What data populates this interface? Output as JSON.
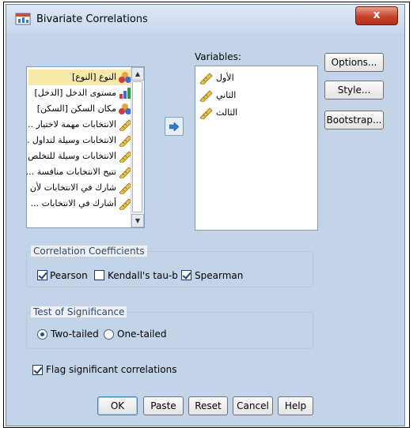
{
  "window": {
    "title": "Bivariate Correlations",
    "close_glyph": "x"
  },
  "source_list": {
    "items": [
      {
        "label": "النوع [النوع]",
        "icon": "nominal-icon",
        "selected": true
      },
      {
        "label": "مستوى الدخل [الدخل]",
        "icon": "ordinal-icon",
        "selected": false
      },
      {
        "label": "مكان السكن [السكن]",
        "icon": "nominal-icon",
        "selected": false
      },
      {
        "label": "الانتخابات مهمة لاختيار ...",
        "icon": "scale-icon",
        "selected": false
      },
      {
        "label": "الانتخابات وسيلة لتداول ...",
        "icon": "scale-icon",
        "selected": false
      },
      {
        "label": "الانتخابات وسيلة للتخلص ...",
        "icon": "scale-icon",
        "selected": false
      },
      {
        "label": "تتيح الانتخابات منافسة ...",
        "icon": "scale-icon",
        "selected": false
      },
      {
        "label": "شارك في الانتخابات لأن ...",
        "icon": "scale-icon",
        "selected": false
      },
      {
        "label": "أشارك في الانتخابات ...",
        "icon": "scale-icon",
        "selected": false
      }
    ]
  },
  "variables": {
    "label": "Variables:",
    "items": [
      {
        "label": "الأول",
        "icon": "scale-icon"
      },
      {
        "label": "الثاني",
        "icon": "scale-icon"
      },
      {
        "label": "الثالث",
        "icon": "scale-icon"
      }
    ]
  },
  "side_buttons": {
    "options": "Options...",
    "style": "Style...",
    "bootstrap": "Bootstrap..."
  },
  "correlation": {
    "title": "Correlation Coefficients",
    "pearson": {
      "label": "Pearson",
      "checked": true
    },
    "kendall": {
      "label": "Kendall's tau-b",
      "checked": false
    },
    "spearman": {
      "label": "Spearman",
      "checked": true
    }
  },
  "significance": {
    "title": "Test of Significance",
    "two_tailed": {
      "label": "Two-tailed",
      "selected": true
    },
    "one_tailed": {
      "label": "One-tailed",
      "selected": false
    }
  },
  "flag": {
    "label": "Flag significant correlations",
    "checked": true
  },
  "buttons": {
    "ok": "OK",
    "paste": "Paste",
    "reset": "Reset",
    "cancel": "Cancel",
    "help": "Help"
  },
  "colors": {
    "title_bar": "#c9d8ec",
    "close_button": "#c6422a",
    "selected_item": "#f7e9a8"
  }
}
